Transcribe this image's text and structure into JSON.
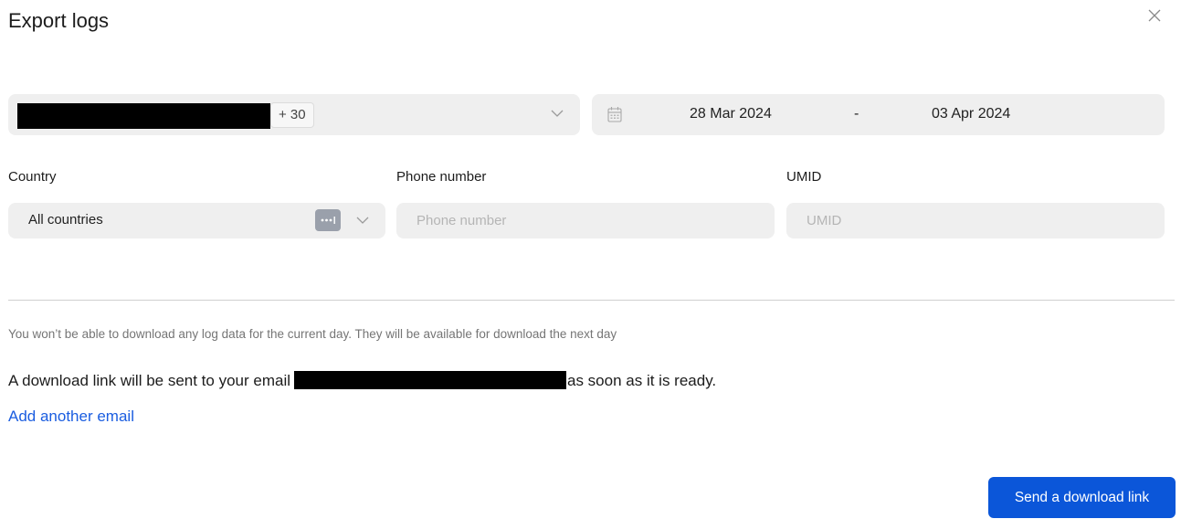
{
  "dialog": {
    "title": "Export logs",
    "close_icon": "close-icon"
  },
  "account_select": {
    "extra_count": "+ 30",
    "chevron_icon": "chevron-down-icon"
  },
  "date_range": {
    "icon": "calendar-icon",
    "from": "28 Mar 2024",
    "separator": "-",
    "to": "03 Apr 2024"
  },
  "filters": {
    "country": {
      "label": "Country",
      "value": "All countries",
      "more_icon": "more-icon"
    },
    "phone": {
      "label": "Phone number",
      "placeholder": "Phone number",
      "value": ""
    },
    "umid": {
      "label": "UMID",
      "placeholder": "UMID",
      "value": ""
    }
  },
  "info": {
    "note": "You won’t be able to download any log data for the current day. They will be available for download the next day",
    "email_prefix": "A download link will be sent to your email",
    "email_suffix": "as soon as it is ready.",
    "add_email": "Add another email"
  },
  "actions": {
    "send_label": "Send a download link"
  },
  "colors": {
    "primary": "#0b56d9",
    "link": "#1a5de0",
    "field_bg": "#efefef"
  }
}
